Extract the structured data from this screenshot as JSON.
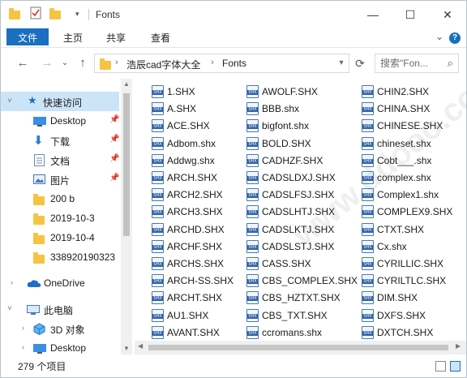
{
  "window": {
    "title": "Fonts",
    "minimize_glyph": "—",
    "maximize_glyph": "☐",
    "close_glyph": "✕"
  },
  "ribbon": {
    "tabs": [
      "文件",
      "主页",
      "共享",
      "查看"
    ],
    "expand_glyph": "⌄",
    "help_glyph": "?"
  },
  "address": {
    "crumbs": [
      "浩辰cad字体大全",
      "Fonts"
    ],
    "separator": "›",
    "search_placeholder": "搜索\"Fon..."
  },
  "nav": {
    "back_glyph": "←",
    "forward_glyph": "→",
    "recent_glyph": "⌄",
    "up_glyph": "↑",
    "quick_access": "快速访问",
    "items": [
      {
        "label": "Desktop",
        "icon": "desktop-icon",
        "pinned": true
      },
      {
        "label": "下载",
        "icon": "download-icon",
        "pinned": true
      },
      {
        "label": "文档",
        "icon": "document-icon",
        "pinned": true
      },
      {
        "label": "图片",
        "icon": "picture-icon",
        "pinned": true
      },
      {
        "label": "200 b",
        "icon": "folder-icon",
        "pinned": false
      },
      {
        "label": "2019-10-3",
        "icon": "folder-icon",
        "pinned": false
      },
      {
        "label": "2019-10-4",
        "icon": "folder-icon",
        "pinned": false
      },
      {
        "label": "338920190323",
        "icon": "folder-icon",
        "pinned": false
      }
    ],
    "onedrive": "OneDrive",
    "this_pc": "此电脑",
    "pc_items": [
      {
        "label": "3D 对象",
        "icon": "3d-objects-icon"
      },
      {
        "label": "Desktop",
        "icon": "desktop-icon"
      }
    ]
  },
  "files": {
    "columns": [
      [
        "1.SHX",
        "A.SHX",
        "ACE.SHX",
        "Adbom.shx",
        "Addwg.shx",
        "ARCH.SHX",
        "ARCH2.SHX",
        "ARCH3.SHX",
        "ARCHD.SHX",
        "ARCHF.SHX",
        "ARCHS.SHX",
        "ARCH-SS.SHX",
        "ARCHT.SHX",
        "AU1.SHX",
        "AVANT.SHX"
      ],
      [
        "AWOLF.SHX",
        "BBB.shx",
        "bigfont.shx",
        "BOLD.SHX",
        "CADHZF.SHX",
        "CADSLDXJ.SHX",
        "CADSLFSJ.SHX",
        "CADSLHTJ.SHX",
        "CADSLKTJ.SHX",
        "CADSLSTJ.SHX",
        "CASS.SHX",
        "CBS_COMPLEX.SHX",
        "CBS_HZTXT.SHX",
        "CBS_TXT.SHX",
        "ccromans.shx"
      ],
      [
        "CHIN2.SHX",
        "CHINA.SHX",
        "CHINESE.SHX",
        "chineset.shx",
        "Cobt___.shx",
        "complex.shx",
        "Complex1.shx",
        "COMPLEX9.SHX",
        "CTXT.SHX",
        "Cx.shx",
        "CYRILLIC.SHX",
        "CYRILTLC.SHX",
        "DIM.SHX",
        "DXFS.SHX",
        "DXTCH.SHX"
      ]
    ]
  },
  "status": {
    "item_count": "279 个项目"
  }
}
